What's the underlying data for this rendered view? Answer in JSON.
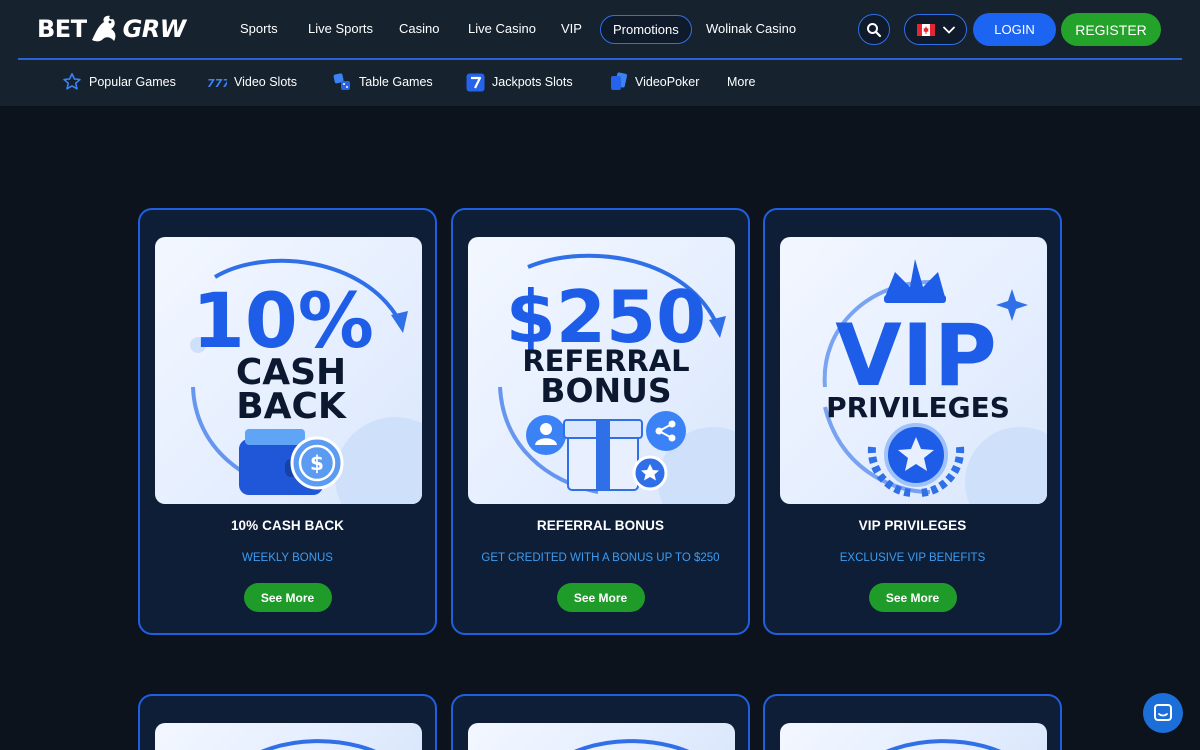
{
  "brand": {
    "logo_left": "BET",
    "logo_right": "GRW"
  },
  "nav": {
    "items": [
      "Sports",
      "Live Sports",
      "Casino",
      "Live Casino",
      "VIP",
      "Promotions",
      "Wolinak Casino"
    ],
    "active": "Promotions"
  },
  "header": {
    "login_label": "LOGIN",
    "register_label": "REGISTER",
    "language_flag": "canada-flag-icon"
  },
  "subnav": {
    "items": [
      {
        "label": "Popular Games",
        "icon": "star-icon"
      },
      {
        "label": "Video Slots",
        "icon": "slots-777-icon"
      },
      {
        "label": "Table Games",
        "icon": "dice-icon"
      },
      {
        "label": "Jackpots Slots",
        "icon": "seven-icon"
      },
      {
        "label": "VideoPoker",
        "icon": "cards-icon"
      },
      {
        "label": "More",
        "icon": ""
      }
    ]
  },
  "promotions": [
    {
      "art_line1": "10%",
      "art_line2": "CASH",
      "art_line3": "BACK",
      "title": "10% CASH BACK",
      "subtitle": "WEEKLY BONUS",
      "button": "See More"
    },
    {
      "art_line1": "$250",
      "art_line2": "REFERRAL",
      "art_line3": "BONUS",
      "title": "REFERRAL BONUS",
      "subtitle": "GET CREDITED WITH A BONUS UP TO $250",
      "button": "See More"
    },
    {
      "art_line1": "VIP",
      "art_line2": "PRIVILEGES",
      "art_line3": "",
      "title": "VIP PRIVILEGES",
      "subtitle": "EXCLUSIVE VIP BENEFITS",
      "button": "See More"
    }
  ],
  "colors": {
    "background": "#0d131d",
    "header": "#17222f",
    "accent_blue": "#1c64f2",
    "register_green": "#23a32a",
    "card_bg": "#0f1e37",
    "card_border": "#1f5fe0",
    "subtitle_blue": "#3b9cf0"
  }
}
